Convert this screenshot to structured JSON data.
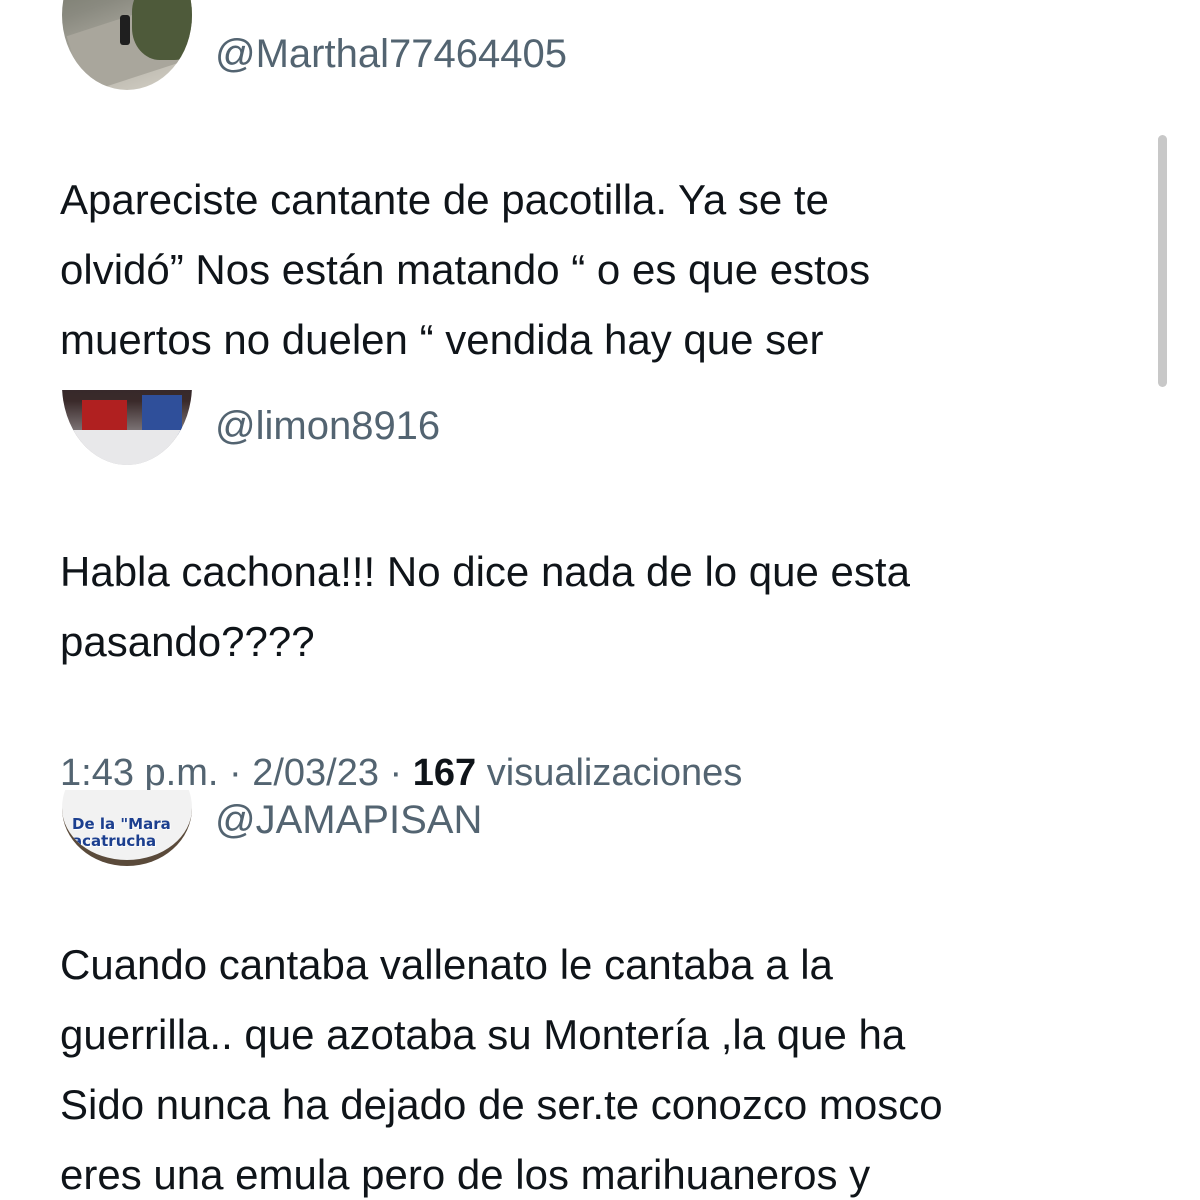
{
  "tweets": [
    {
      "handle": "@Marthal77464405",
      "avatar_icon": "road-photo-avatar",
      "text_lines": [
        "Apareciste cantante de pacotilla. Ya se te",
        "olvidó” Nos están matando “ o es que estos",
        "muertos no duelen “ vendida hay que ser"
      ]
    },
    {
      "handle": "@limon8916",
      "avatar_icon": "street-photo-avatar",
      "text_lines": [
        "Habla cachona!!! No dice nada de lo que esta",
        "pasando????"
      ],
      "meta": {
        "time": "1:43 p.m.",
        "sep1": " · ",
        "date": "2/03/23",
        "sep2": " · ",
        "views_count": "167",
        "views_label": " visualizaciones"
      }
    },
    {
      "handle": "@JAMAPISAN",
      "avatar_icon": "logo-avatar",
      "avatar_text_line1": "De la \"Mara",
      "avatar_text_line2": "acatrucha",
      "text_lines": [
        "Cuando cantaba vallenato le cantaba a la",
        "guerrilla.. que azotaba su Montería ,la que ha",
        "Sido nunca ha dejado de ser.te conozco mosco",
        "eres una emula pero de los marihuaneros y"
      ]
    }
  ],
  "colors": {
    "text_primary": "#0f1419",
    "text_secondary": "#536471",
    "background": "#ffffff"
  }
}
